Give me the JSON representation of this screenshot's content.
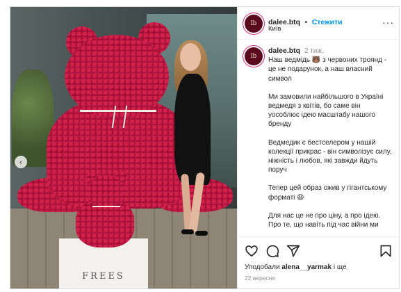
{
  "post": {
    "username": "dalee.btq",
    "avatar_letters": "lb",
    "follow_label": "Стежити",
    "separator": "•",
    "location": "Київ",
    "more_label": "···",
    "prev_label": "‹",
    "pedestal_text": "FREES",
    "caption": {
      "username": "dalee.btq",
      "time_ago": "2 тиж.",
      "paragraphs": [
        "Наш ведмідь 🐻 з червоних троянд - це не подарунок, а наш власний символ",
        "Ми замовили найбільшого в Україні ведмедя з квітів, бо саме він уособлює ідею масштабу нашого бренду",
        "Ведмедик є бестселером у нашій колекції прикрас - він символізує силу, ніжність і любов, які завжди йдуть поруч",
        "Тепер цей образ ожив у гігантському форматі 😆",
        "Для нас це не про ціну, а про ідею. Про те, що навіть під час війни ми"
      ]
    },
    "likes_prefix": "Уподобали",
    "likes_user": "alena__yarmak",
    "likes_suffix": "і ще",
    "date": "22 вересня"
  },
  "icons": {
    "like": "heart-icon",
    "comment": "comment-icon",
    "share": "share-icon",
    "save": "bookmark-icon"
  },
  "colors": {
    "follow": "#0095f6",
    "roses": "#b01540",
    "avatar_bg": "#5a0c1e"
  }
}
